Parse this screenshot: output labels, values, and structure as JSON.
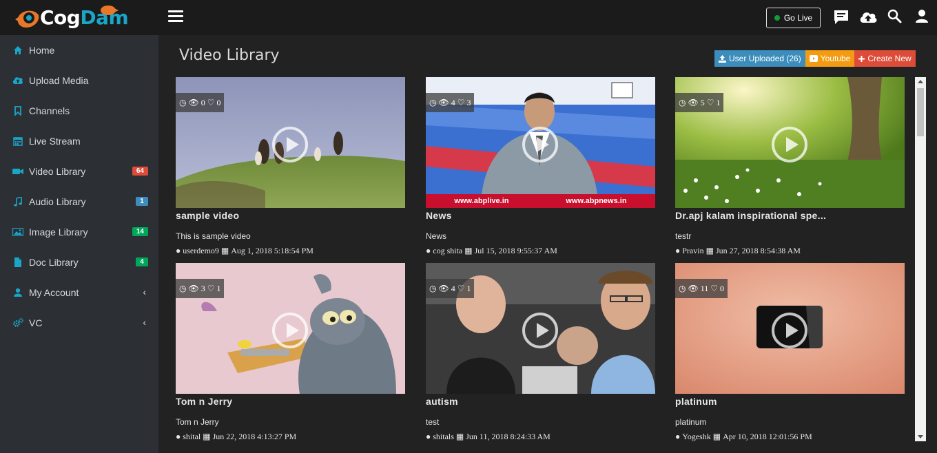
{
  "header": {
    "logo_cog": "Cog",
    "logo_dam": "Dam",
    "golive_label": "Go Live"
  },
  "sidebar": {
    "items": [
      {
        "label": "Home",
        "icon": "home-icon"
      },
      {
        "label": "Upload Media",
        "icon": "cloud-upload-icon"
      },
      {
        "label": "Channels",
        "icon": "bookmark-icon"
      },
      {
        "label": "Live Stream",
        "icon": "calendar-icon"
      },
      {
        "label": "Video Library",
        "icon": "video-camera-icon",
        "badge": "64",
        "badge_color": "#dd4b39"
      },
      {
        "label": "Audio Library",
        "icon": "music-icon",
        "badge": "1",
        "badge_color": "#3c8dbc"
      },
      {
        "label": "Image Library",
        "icon": "image-icon",
        "badge": "14",
        "badge_color": "#00a65a"
      },
      {
        "label": "Doc Library",
        "icon": "file-icon",
        "badge": "4",
        "badge_color": "#00a65a"
      },
      {
        "label": "My Account",
        "icon": "user-icon",
        "chevron": "‹"
      },
      {
        "label": "VC",
        "icon": "cogs-icon",
        "chevron": "‹"
      }
    ]
  },
  "main": {
    "title": "Video Library",
    "filters": {
      "user_uploaded": "User Uploaded (26)",
      "youtube": "Youtube",
      "create_new": "Create New"
    },
    "videos": [
      {
        "title": "sample video",
        "views": "0",
        "likes": "0",
        "description": "This is sample video",
        "user": "userdemo9",
        "date": "Aug 1, 2018 5:18:54 PM"
      },
      {
        "title": "News",
        "views": "4",
        "likes": "3",
        "description": "News",
        "user": "cog shita",
        "date": "Jul 15, 2018 9:55:37 AM"
      },
      {
        "title": "Dr.apj kalam inspirational spe...",
        "views": "5",
        "likes": "1",
        "description": "testr",
        "user": "Pravin",
        "date": "Jun 27, 2018 8:54:38 AM"
      },
      {
        "title": "Tom n Jerry",
        "views": "3",
        "likes": "1",
        "description": "Tom n Jerry",
        "user": "shital",
        "date": "Jun 22, 2018 4:13:27 PM"
      },
      {
        "title": "autism",
        "views": "4",
        "likes": "1",
        "description": "test",
        "user": "shitals",
        "date": "Jun 11, 2018 8:24:33 AM"
      },
      {
        "title": "platinum",
        "views": "11",
        "likes": "0",
        "description": "platinum",
        "user": "Yogeshk",
        "date": "Apr 10, 2018 12:01:56 PM"
      }
    ],
    "news_ticker_left": "www.abplive.in",
    "news_ticker_right": "www.abpnews.in"
  },
  "colors": {
    "accent": "#19a6c9",
    "brand_orange": "#e8772a",
    "sidebar_bg": "#2c3034",
    "main_bg": "#222222"
  }
}
